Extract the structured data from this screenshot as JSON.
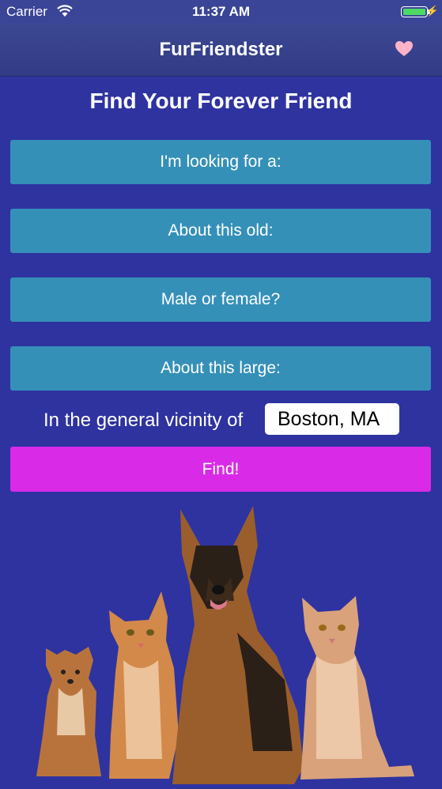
{
  "status_bar": {
    "carrier": "Carrier",
    "time": "11:37 AM",
    "battery_color": "#4cd964"
  },
  "nav": {
    "title": "FurFriendster",
    "favorites_icon": "heart-icon",
    "heart_color": "#ffb3c8"
  },
  "main": {
    "title": "Find Your Forever Friend",
    "type_button": "I'm looking for a:",
    "age_button": "About this old:",
    "gender_button": "Male or female?",
    "size_button": "About this large:",
    "vicinity_label": "In the general vicinity of",
    "location_value": "Boston, MA",
    "find_button": "Find!"
  },
  "colors": {
    "background": "#2e33a0",
    "option_button": "#3590b8",
    "find_button": "#d92ae8"
  },
  "image": {
    "subject": "dogs-and-cats-group"
  }
}
